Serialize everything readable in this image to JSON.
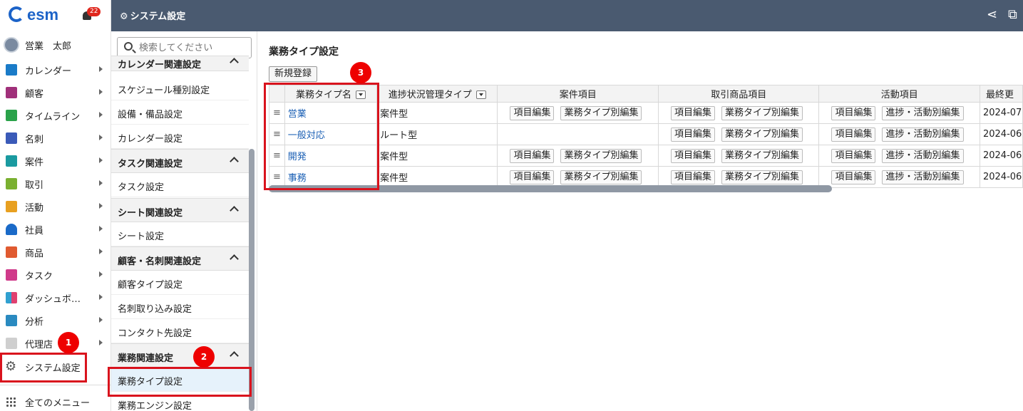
{
  "app": {
    "brand": "esm",
    "notification_count": "22"
  },
  "user": {
    "name": "営業　太郎"
  },
  "nav": {
    "items": [
      {
        "label": "カレンダー",
        "icon": "calendar-icon",
        "color": "#1a7bc8"
      },
      {
        "label": "顧客",
        "icon": "building-icon",
        "color": "#a0307a"
      },
      {
        "label": "タイムライン",
        "icon": "chat-icon",
        "color": "#2aa24a"
      },
      {
        "label": "名刺",
        "icon": "card-icon",
        "color": "#3a5ab8"
      },
      {
        "label": "案件",
        "icon": "case-icon",
        "color": "#1a9aa0"
      },
      {
        "label": "取引",
        "icon": "deal-icon",
        "color": "#7ab030"
      },
      {
        "label": "活動",
        "icon": "activity-icon",
        "color": "#e8a020"
      },
      {
        "label": "社員",
        "icon": "person-icon",
        "color": "#1a6ac8"
      },
      {
        "label": "商品",
        "icon": "product-icon",
        "color": "#e05a30"
      },
      {
        "label": "タスク",
        "icon": "task-icon",
        "color": "#d03a8a"
      },
      {
        "label": "ダッシュボ…",
        "icon": "dashboard-icon",
        "color": "#30a0d0"
      },
      {
        "label": "分析",
        "icon": "chart-icon",
        "color": "#2a8ac0"
      },
      {
        "label": "代理店",
        "icon": "agency-icon",
        "color": "#999999"
      }
    ],
    "system": "システム設定",
    "all_menu": "全てのメニュー"
  },
  "header": {
    "title": "システム設定"
  },
  "settings_menu": {
    "search_placeholder": "検索してください",
    "partial_header": "カレンダー関連設定",
    "calendar_items": [
      "スケジュール種別設定",
      "設備・備品設定",
      "カレンダー設定"
    ],
    "task_header": "タスク関連設定",
    "task_items": [
      "タスク設定"
    ],
    "sheet_header": "シート関連設定",
    "sheet_items": [
      "シート設定"
    ],
    "customer_header": "顧客・名刺関連設定",
    "customer_items": [
      "顧客タイプ設定",
      "名刺取り込み設定",
      "コンタクト先設定"
    ],
    "business_header": "業務関連設定",
    "business_items": [
      "業務タイプ設定",
      "業務エンジン設定"
    ]
  },
  "main": {
    "title": "業務タイプ設定",
    "new_button": "新規登録",
    "columns": [
      "業務タイプ名",
      "進捗状況管理タイプ",
      "案件項目",
      "取引商品項目",
      "活動項目",
      "最終更"
    ],
    "btn_item_edit": "項目編集",
    "btn_type_edit": "業務タイプ別編集",
    "btn_progress_edit": "進捗・活動別編集",
    "rows": [
      {
        "name": "営業",
        "type": "案件型",
        "date": "2024-07"
      },
      {
        "name": "一般対応",
        "type": "ルート型",
        "date": "2024-06"
      },
      {
        "name": "開発",
        "type": "案件型",
        "date": "2024-06"
      },
      {
        "name": "事務",
        "type": "案件型",
        "date": "2024-06"
      }
    ]
  },
  "annotations": [
    "1",
    "2",
    "3"
  ]
}
